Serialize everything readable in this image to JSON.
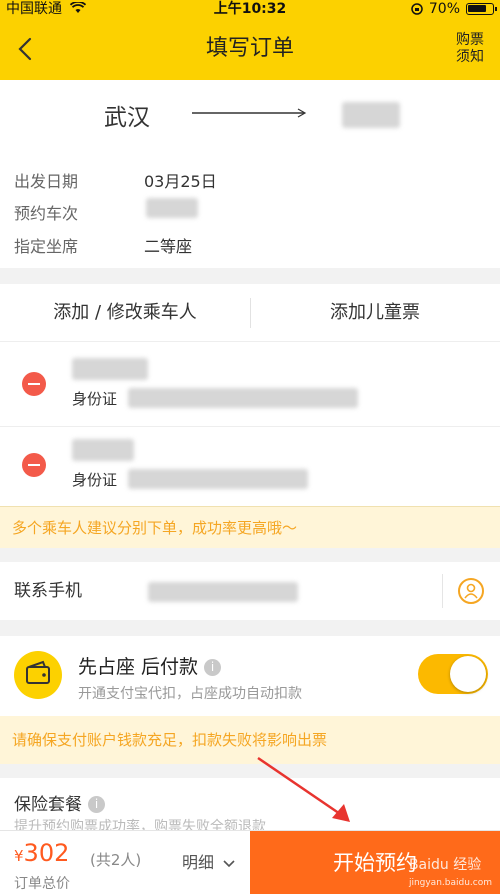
{
  "status_bar": {
    "carrier": "中国联通",
    "time": "上午10:32",
    "battery": "70%"
  },
  "nav": {
    "title": "填写订单",
    "notice_line1": "购票",
    "notice_line2": "须知",
    "bg_color": "#fcd100"
  },
  "route": {
    "from": "武汉",
    "rows": [
      {
        "label": "出发日期",
        "value": "03月25日"
      },
      {
        "label": "预约车次",
        "value": ""
      },
      {
        "label": "指定坐席",
        "value": "二等座"
      }
    ]
  },
  "passengers": {
    "add_passenger": "添加 / 修改乘车人",
    "add_child": "添加儿童票",
    "items": [
      {
        "id_label": "身份证"
      },
      {
        "id_label": "身份证"
      }
    ],
    "tip": "多个乘车人建议分别下单，成功率更高哦～"
  },
  "contact": {
    "label": "联系手机"
  },
  "prepay": {
    "title": "先占座 后付款",
    "desc": "开通支付宝代扣，占座成功自动扣款",
    "enabled": true,
    "warning": "请确保支付账户钱款充足，扣款失败将影响出票"
  },
  "insurance": {
    "title": "保险套餐",
    "desc": "提升预约购票成功率，购票失败全额退款"
  },
  "footer": {
    "currency": "¥",
    "amount": "302",
    "count": "(共2人)",
    "total_label": "订单总价",
    "detail": "明细",
    "cta": "开始预约",
    "accent": "#ff6a1a"
  },
  "watermark": {
    "text": "Baidu 经验",
    "url": "jingyan.baidu.com"
  },
  "icons": [
    "wifi-icon",
    "battery-icon",
    "back-arrow-icon",
    "minus-circle-icon",
    "person-icon",
    "wallet-icon",
    "info-icon",
    "chevron-down-icon"
  ]
}
